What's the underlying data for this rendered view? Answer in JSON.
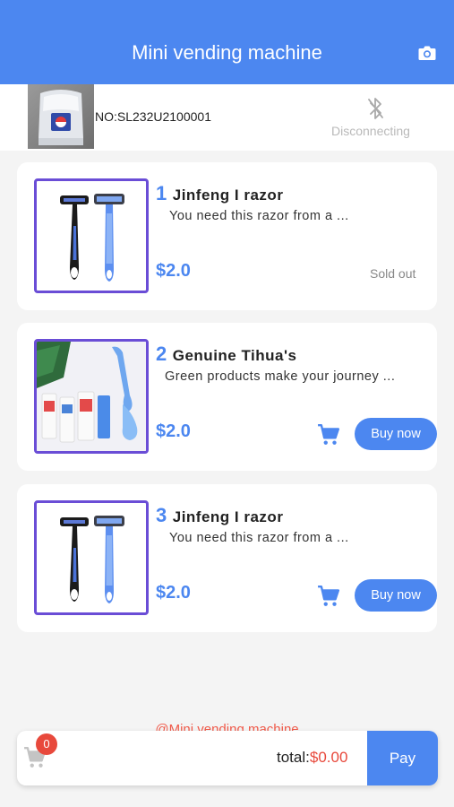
{
  "header": {
    "title": "Mini vending machine",
    "camera_icon": "camera-icon"
  },
  "device": {
    "number": "NO:SL232U2100001",
    "status": "Disconnecting",
    "status_icon": "bluetooth-off-icon"
  },
  "products": [
    {
      "index": "1",
      "name": "Jinfeng I razor",
      "description": "You need this razor from a ...",
      "price": "$2.0",
      "status": "Sold out",
      "image": "razor"
    },
    {
      "index": "2",
      "name": "Genuine Tihua's",
      "description": "Green products make your journey ...",
      "price": "$2.0",
      "buy_label": "Buy now",
      "image": "toothpaste-kit"
    },
    {
      "index": "3",
      "name": "Jinfeng I razor",
      "description": "You need this razor from a ...",
      "price": "$2.0",
      "buy_label": "Buy now",
      "image": "razor"
    }
  ],
  "footer": {
    "brand": "@Mini vending machine"
  },
  "cart": {
    "count": "0",
    "total_label": "total:",
    "total_value": "$0.00",
    "pay_label": "Pay"
  },
  "colors": {
    "accent": "#4c87f0",
    "alert": "#e8493c",
    "thumb_border": "#6a4dd6"
  }
}
